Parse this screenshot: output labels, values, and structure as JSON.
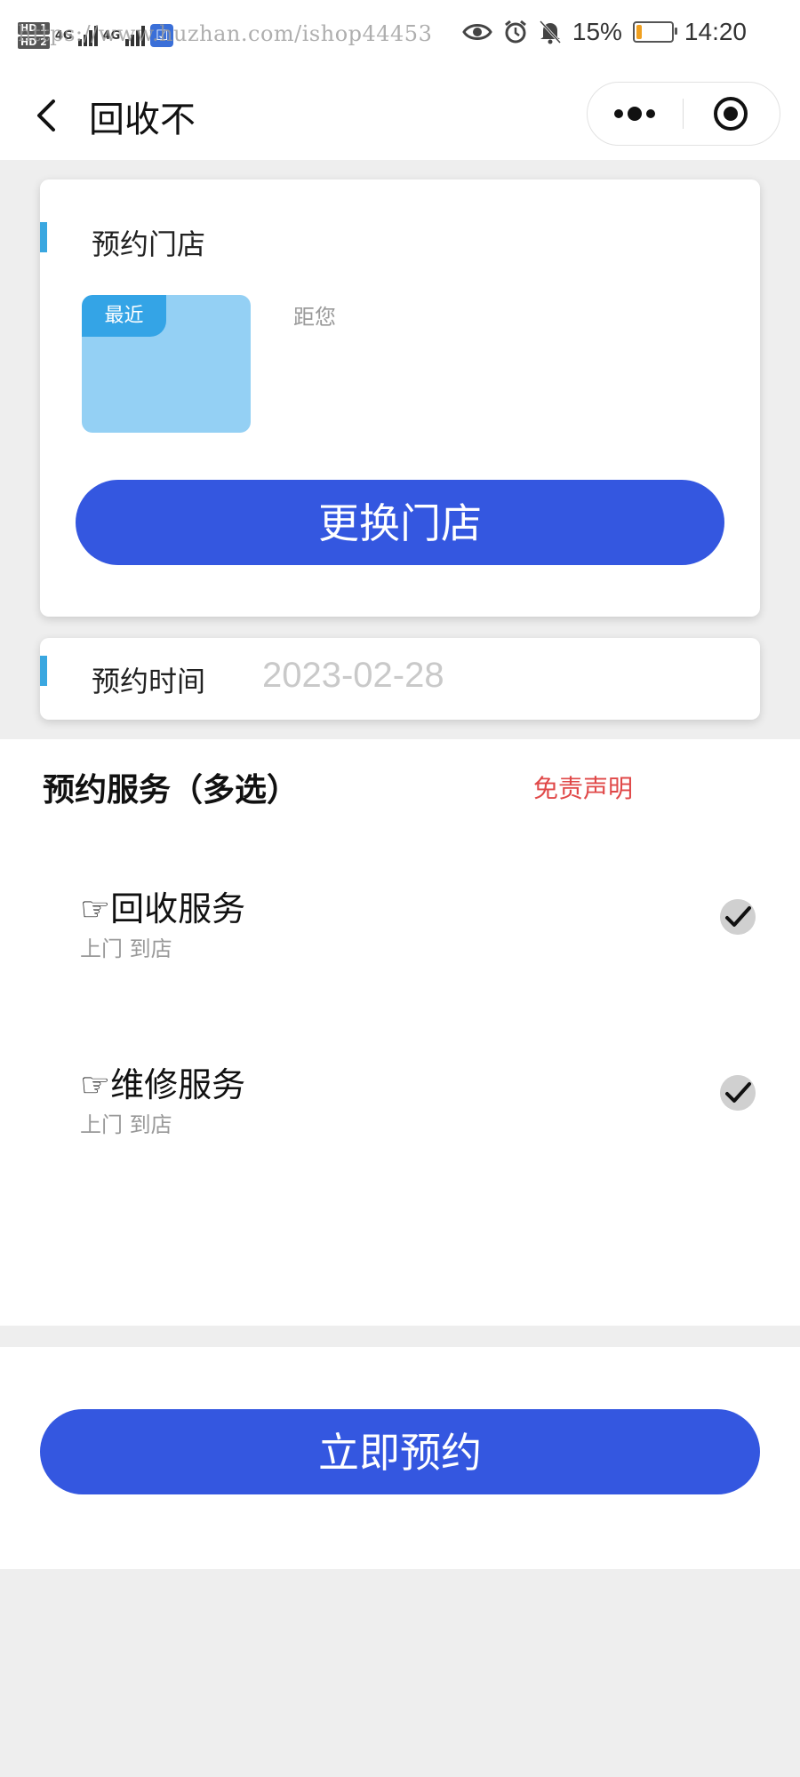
{
  "status_bar": {
    "hd1": "HD 1",
    "hd2": "HD 2",
    "network1": "4G",
    "network2": "4G",
    "watermark": "https://www.huzhan.com/ishop44453",
    "battery_percent": "15%",
    "battery_level": 0.15,
    "time": "14:20",
    "icons": [
      "eye-icon",
      "alarm-icon",
      "bell-off-icon",
      "battery-icon"
    ]
  },
  "nav": {
    "title": "回收不",
    "back_icon": "chevron-left-icon",
    "more_icon": "more-dots-icon",
    "close_icon": "target-icon"
  },
  "store_card": {
    "title": "预约门店",
    "badge": "最近",
    "distance_label": "距您",
    "change_button": "更换门店"
  },
  "time_card": {
    "title": "预约时间",
    "date": "2023-02-28"
  },
  "services": {
    "title": "预约服务（多选）",
    "disclaimer": "免责声明",
    "items": [
      {
        "name": "☞回收服务",
        "sub": "上门 到店",
        "checked": true
      },
      {
        "name": "☞维修服务",
        "sub": "上门 到店",
        "checked": true
      }
    ]
  },
  "footer": {
    "book_button": "立即预约"
  },
  "colors": {
    "primary": "#3457e0",
    "accent": "#3aa7e0",
    "disclaimer": "#e04848",
    "background": "#eeeeee"
  }
}
